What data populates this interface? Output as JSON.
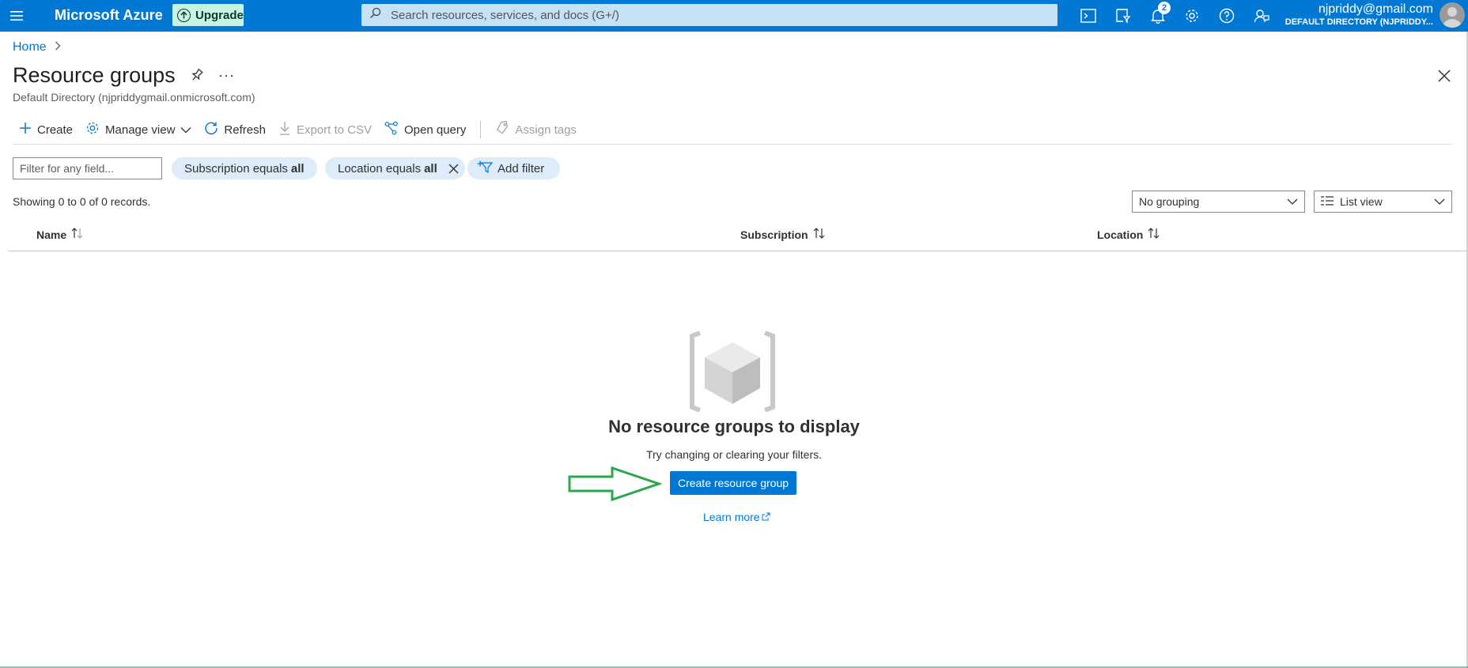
{
  "topbar": {
    "brand": "Microsoft Azure",
    "upgrade_label": "Upgrade",
    "search_placeholder": "Search resources, services, and docs (G+/)",
    "notification_count": "2",
    "account_email": "njpriddy@gmail.com",
    "account_directory": "DEFAULT DIRECTORY (NJPRIDDY...",
    "icons": [
      "cloud-shell-icon",
      "directory-filter-icon",
      "notifications-icon",
      "settings-icon",
      "help-icon",
      "feedback-icon"
    ]
  },
  "breadcrumb": {
    "home": "Home"
  },
  "page": {
    "title": "Resource groups",
    "subtitle": "Default Directory (njpriddygmail.onmicrosoft.com)"
  },
  "toolbar": {
    "create": "Create",
    "manage_view": "Manage view",
    "refresh": "Refresh",
    "export_csv": "Export to CSV",
    "open_query": "Open query",
    "assign_tags": "Assign tags"
  },
  "filters": {
    "placeholder": "Filter for any field...",
    "subscription_prefix": "Subscription equals ",
    "subscription_value": "all",
    "location_prefix": "Location equals ",
    "location_value": "all",
    "add_filter": "Add filter"
  },
  "records_text": "Showing 0 to 0 of 0 records.",
  "grouping": {
    "selected": "No grouping"
  },
  "view": {
    "selected": "List view"
  },
  "table": {
    "columns": [
      "Name",
      "Subscription",
      "Location"
    ]
  },
  "empty_state": {
    "title": "No resource groups to display",
    "subtitle": "Try changing or clearing your filters.",
    "create_button": "Create resource group",
    "learn_more": "Learn more"
  },
  "colors": {
    "brand_blue": "#0078d4",
    "upgrade_bg": "#c7f3e2",
    "arrow_green": "#2aa84a"
  }
}
